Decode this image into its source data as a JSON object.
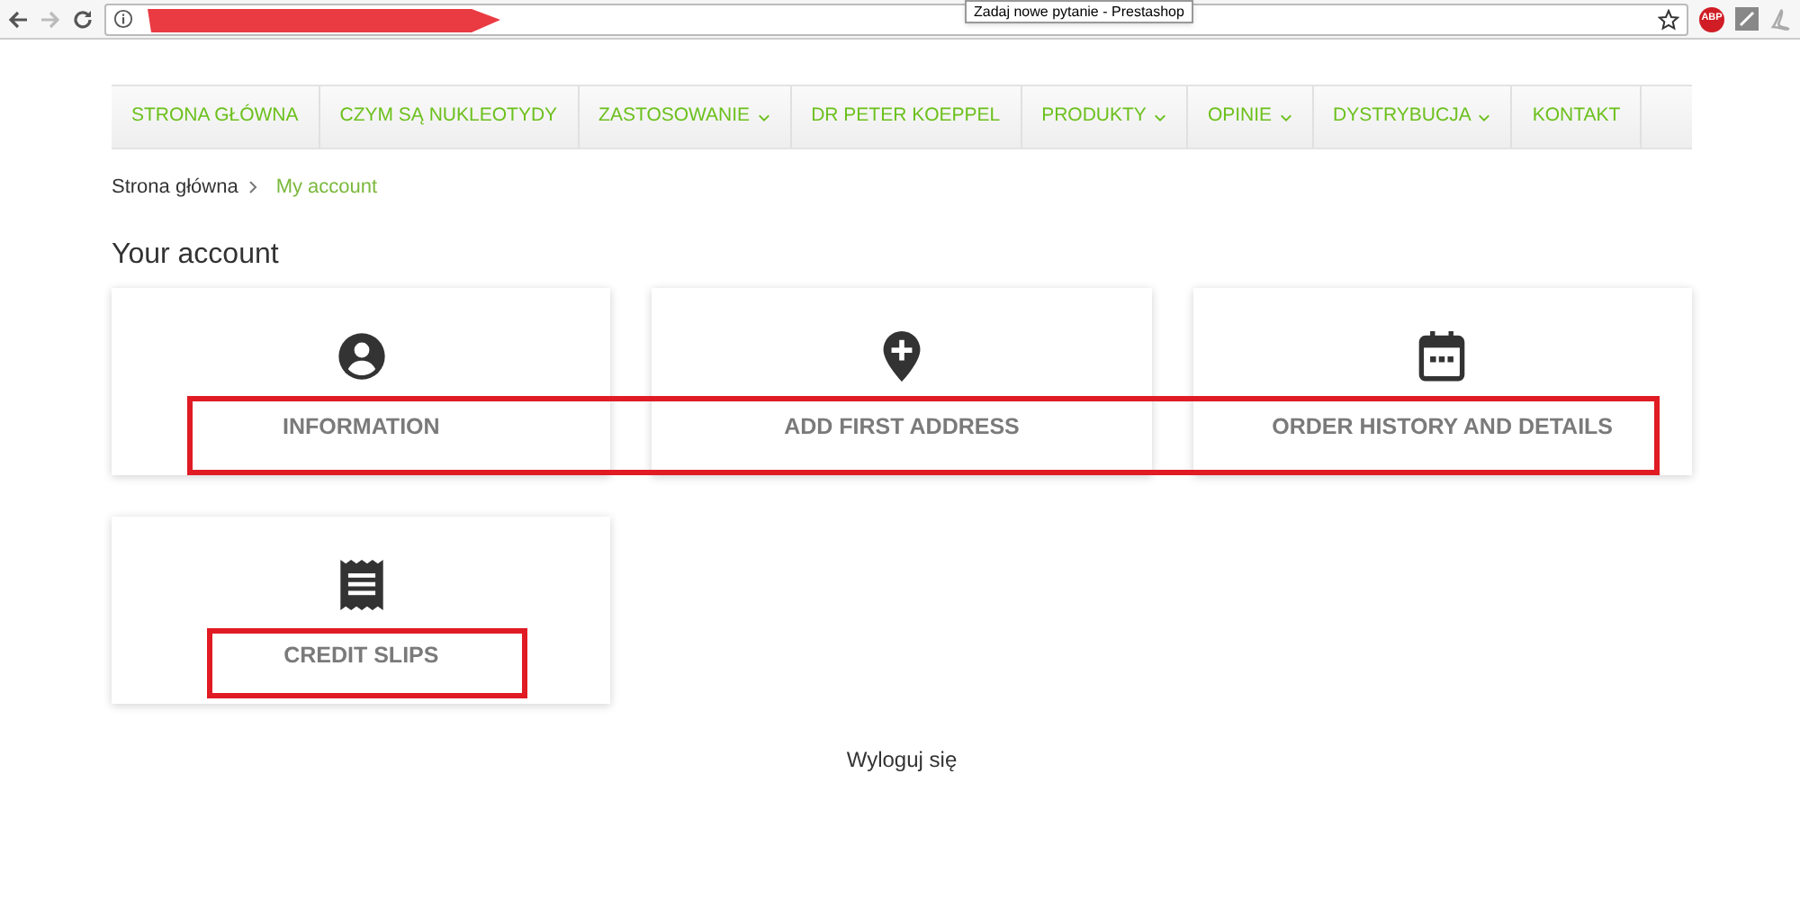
{
  "browser": {
    "tooltip": "Zadaj nowe pytanie - Prestashop",
    "extension_badge": "ABP"
  },
  "nav": [
    {
      "label": "STRONA GŁÓWNA",
      "dropdown": false
    },
    {
      "label": "CZYM SĄ NUKLEOTYDY",
      "dropdown": false
    },
    {
      "label": "ZASTOSOWANIE",
      "dropdown": true
    },
    {
      "label": "DR PETER KOEPPEL",
      "dropdown": false
    },
    {
      "label": "PRODUKTY",
      "dropdown": true
    },
    {
      "label": "OPINIE",
      "dropdown": true
    },
    {
      "label": "DYSTRYBUCJA",
      "dropdown": true
    },
    {
      "label": "KONTAKT",
      "dropdown": false
    }
  ],
  "breadcrumb": [
    "Strona główna",
    "My account"
  ],
  "title": "Your account",
  "cards": [
    {
      "label": "INFORMATION",
      "kind": "user"
    },
    {
      "label": "ADD FIRST ADDRESS",
      "kind": "pin"
    },
    {
      "label": "ORDER HISTORY AND DETAILS",
      "kind": "calendar"
    },
    {
      "label": "CREDIT SLIPS",
      "kind": "receipt"
    }
  ],
  "logout": "Wyloguj się"
}
